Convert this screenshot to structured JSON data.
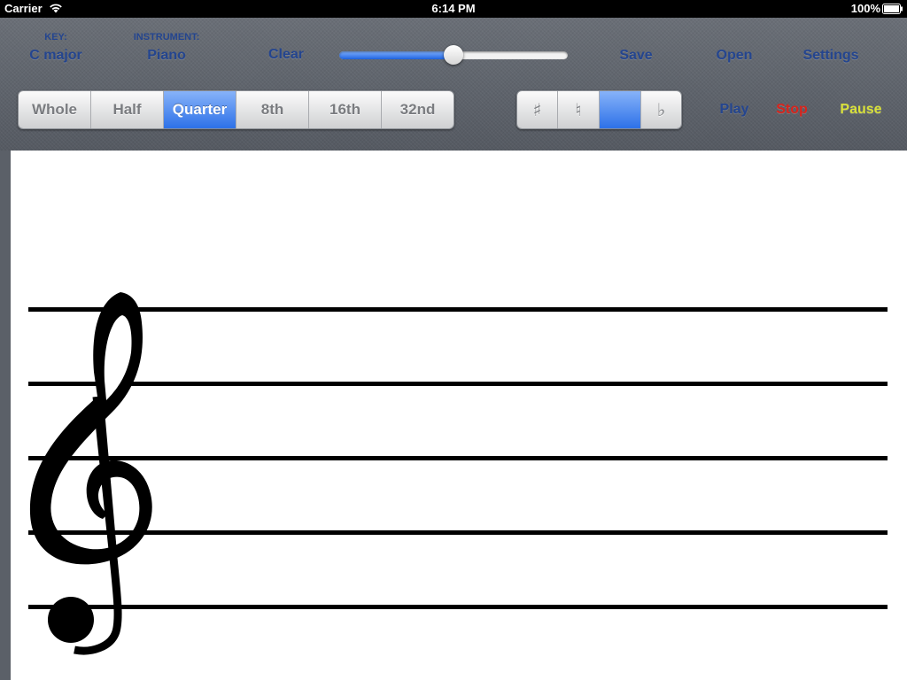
{
  "status": {
    "carrier": "Carrier",
    "time": "6:14 PM",
    "battery": "100%"
  },
  "toolbar": {
    "key": {
      "label": "KEY:",
      "value": "C major"
    },
    "instrument": {
      "label": "INSTRUMENT:",
      "value": "Piano"
    },
    "clear": "Clear",
    "volume_fraction": 0.5,
    "save": "Save",
    "open": "Open",
    "settings": "Settings",
    "durations": [
      {
        "label": "Whole",
        "selected": false
      },
      {
        "label": "Half",
        "selected": false
      },
      {
        "label": "Quarter",
        "selected": true
      },
      {
        "label": "8th",
        "selected": false
      },
      {
        "label": "16th",
        "selected": false
      },
      {
        "label": "32nd",
        "selected": false
      }
    ],
    "accidentals": [
      {
        "label": "♯",
        "icon": "sharp-icon",
        "selected": false
      },
      {
        "label": "♮",
        "icon": "natural-icon",
        "selected": false
      },
      {
        "label": "",
        "icon": "none",
        "selected": true
      },
      {
        "label": "♭",
        "icon": "flat-icon",
        "selected": false
      }
    ],
    "play": "Play",
    "stop": "Stop",
    "pause": "Pause"
  },
  "colors": {
    "button_text": "#24458f",
    "stop": "#d8241c",
    "pause": "#d8e03a",
    "selected_segment": "#2d71e8"
  },
  "staff": {
    "clef": "treble-clef-icon",
    "line_count": 5
  }
}
